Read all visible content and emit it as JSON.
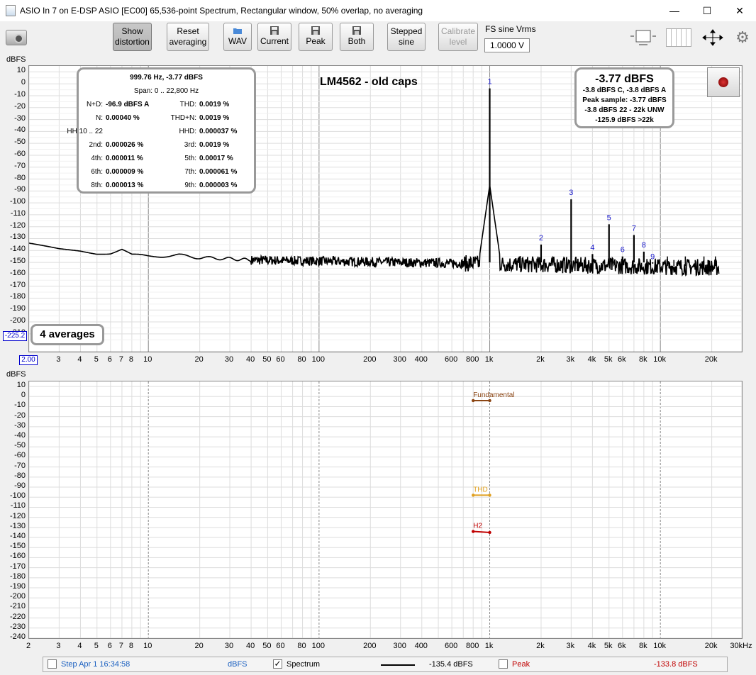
{
  "window": {
    "title": "ASIO In 7 on E-DSP ASIO [EC00] 65,536-point Spectrum, Rectangular window, 50% overlap, no averaging",
    "min": "—",
    "max": "☐",
    "close": "✕"
  },
  "toolbar": {
    "show_distortion": [
      "Show",
      "distortion"
    ],
    "reset_averaging": [
      "Reset",
      "averaging"
    ],
    "wav": "WAV",
    "current": "Current",
    "peak": "Peak",
    "both": "Both",
    "stepped_sine": [
      "Stepped",
      "sine"
    ],
    "calibrate_level": [
      "Calibrate",
      "level"
    ],
    "fs_label": "FS sine Vrms",
    "fs_value": "1.0000 V"
  },
  "spectrum": {
    "y_unit": "dBFS",
    "y_ticks": [
      10,
      0,
      -10,
      -20,
      -30,
      -40,
      -50,
      -60,
      -70,
      -80,
      -90,
      -100,
      -110,
      -120,
      -130,
      -140,
      -150,
      -160,
      -170,
      -180,
      -190,
      -200,
      -210
    ],
    "x_ticks": [
      {
        "v": 3,
        "t": "3"
      },
      {
        "v": 4,
        "t": "4"
      },
      {
        "v": 5,
        "t": "5"
      },
      {
        "v": 6,
        "t": "6"
      },
      {
        "v": 7,
        "t": "7"
      },
      {
        "v": 8,
        "t": "8"
      },
      {
        "v": 10,
        "t": "10"
      },
      {
        "v": 20,
        "t": "20"
      },
      {
        "v": 30,
        "t": "30"
      },
      {
        "v": 40,
        "t": "40"
      },
      {
        "v": 50,
        "t": "50"
      },
      {
        "v": 60,
        "t": "60"
      },
      {
        "v": 80,
        "t": "80"
      },
      {
        "v": 100,
        "t": "100"
      },
      {
        "v": 200,
        "t": "200"
      },
      {
        "v": 300,
        "t": "300"
      },
      {
        "v": 400,
        "t": "400"
      },
      {
        "v": 600,
        "t": "600"
      },
      {
        "v": 800,
        "t": "800"
      },
      {
        "v": 1000,
        "t": "1k"
      },
      {
        "v": 2000,
        "t": "2k"
      },
      {
        "v": 3000,
        "t": "3k"
      },
      {
        "v": 4000,
        "t": "4k"
      },
      {
        "v": 5000,
        "t": "5k"
      },
      {
        "v": 6000,
        "t": "6k"
      },
      {
        "v": 8000,
        "t": "8k"
      },
      {
        "v": 10000,
        "t": "10k"
      },
      {
        "v": 20000,
        "t": "20k"
      }
    ],
    "x_start": "2.00",
    "cursor_value": "-225.2",
    "title": "LM4562 - old caps",
    "averages": "4 averages",
    "harmonic_markers": [
      {
        "n": "1",
        "f": 1000,
        "db": -3.8
      },
      {
        "n": "2",
        "f": 2000,
        "db": -135
      },
      {
        "n": "3",
        "f": 3000,
        "db": -97
      },
      {
        "n": "4",
        "f": 4000,
        "db": -143
      },
      {
        "n": "5",
        "f": 5000,
        "db": -118
      },
      {
        "n": "6",
        "f": 6000,
        "db": -145
      },
      {
        "n": "7",
        "f": 7000,
        "db": -127
      },
      {
        "n": "8",
        "f": 8000,
        "db": -141
      },
      {
        "n": "9",
        "f": 9000,
        "db": -151
      }
    ],
    "stats": {
      "header": "999.76 Hz, -3.77 dBFS",
      "span": "Span: 0 .. 22,800 Hz",
      "rows": [
        {
          "k1": "N+D:",
          "v1": "-96.9 dBFS A",
          "k2": "THD:",
          "v2": "0.0019 %"
        },
        {
          "k1": "N:",
          "v1": "0.00040 %",
          "k2": "THD+N:",
          "v2": "0.0019 %"
        },
        {
          "k1": "HH 10 .. 22",
          "v1": "",
          "k2": "HHD:",
          "v2": "0.000037 %"
        },
        {
          "k1": "2nd:",
          "v1": "0.000026 %",
          "k2": "3rd:",
          "v2": "0.0019 %"
        },
        {
          "k1": "4th:",
          "v1": "0.000011 %",
          "k2": "5th:",
          "v2": "0.00017 %"
        },
        {
          "k1": "6th:",
          "v1": "0.000009 %",
          "k2": "7th:",
          "v2": "0.000061 %"
        },
        {
          "k1": "8th:",
          "v1": "0.000013 %",
          "k2": "9th:",
          "v2": "0.000003 %"
        }
      ]
    },
    "level": {
      "main": "-3.77 dBFS",
      "line1": "-3.8 dBFS C, -3.8 dBFS A",
      "line2": "Peak sample: -3.77 dBFS",
      "line3": "-3.8 dBFS 22 - 22k UNW",
      "line4": "-125.9 dBFS >22k"
    }
  },
  "distortion": {
    "y_unit": "dBFS",
    "y_ticks": [
      10,
      0,
      -10,
      -20,
      -30,
      -40,
      -50,
      -60,
      -70,
      -80,
      -90,
      -100,
      -110,
      -120,
      -130,
      -140,
      -150,
      -160,
      -170,
      -180,
      -190,
      -200,
      -210,
      -220,
      -230,
      -240
    ],
    "x_ticks": [
      {
        "v": 2,
        "t": "2"
      },
      {
        "v": 3,
        "t": "3"
      },
      {
        "v": 4,
        "t": "4"
      },
      {
        "v": 5,
        "t": "5"
      },
      {
        "v": 6,
        "t": "6"
      },
      {
        "v": 7,
        "t": "7"
      },
      {
        "v": 8,
        "t": "8"
      },
      {
        "v": 10,
        "t": "10"
      },
      {
        "v": 20,
        "t": "20"
      },
      {
        "v": 30,
        "t": "30"
      },
      {
        "v": 40,
        "t": "40"
      },
      {
        "v": 50,
        "t": "50"
      },
      {
        "v": 60,
        "t": "60"
      },
      {
        "v": 80,
        "t": "80"
      },
      {
        "v": 100,
        "t": "100"
      },
      {
        "v": 200,
        "t": "200"
      },
      {
        "v": 300,
        "t": "300"
      },
      {
        "v": 400,
        "t": "400"
      },
      {
        "v": 600,
        "t": "600"
      },
      {
        "v": 800,
        "t": "800"
      },
      {
        "v": 1000,
        "t": "1k"
      },
      {
        "v": 2000,
        "t": "2k"
      },
      {
        "v": 3000,
        "t": "3k"
      },
      {
        "v": 4000,
        "t": "4k"
      },
      {
        "v": 5000,
        "t": "5k"
      },
      {
        "v": 6000,
        "t": "6k"
      },
      {
        "v": 8000,
        "t": "8k"
      },
      {
        "v": 10000,
        "t": "10k"
      },
      {
        "v": 20000,
        "t": "20k"
      },
      {
        "v": 30000,
        "t": "30kHz"
      }
    ],
    "traces": [
      {
        "name": "Fundamental",
        "db": -4,
        "color": "#8b4513"
      },
      {
        "name": "THD",
        "db": -98,
        "color": "#e0a020"
      },
      {
        "name": "H2",
        "db": -135,
        "color": "#c00000"
      }
    ]
  },
  "chart_data": [
    {
      "type": "line",
      "title": "LM4562 - old caps",
      "ylabel": "dBFS",
      "xlabel": "",
      "x_scale": "log",
      "xlim": [
        2,
        30000
      ],
      "ylim": [
        -225,
        15
      ],
      "grid": true,
      "series": [
        {
          "x": [
            2,
            3,
            4,
            5,
            6,
            7,
            8,
            10,
            15,
            20,
            30,
            40,
            60,
            100,
            200,
            400,
            700,
            900,
            1000,
            1100,
            1500,
            2000,
            3000,
            4000,
            5000,
            6000,
            7000,
            8000,
            9000,
            10000,
            15000,
            20000,
            22000
          ],
          "y": [
            -135,
            -139,
            -140,
            -142,
            -142,
            -139,
            -144,
            -145,
            -144,
            -146,
            -147,
            -148,
            -149,
            -150,
            -151,
            -152,
            -149,
            -143,
            -3.8,
            -148,
            -152,
            -135,
            -97,
            -143,
            -118,
            -145,
            -127,
            -141,
            -151,
            -154,
            -154,
            -155,
            -158
          ]
        }
      ]
    },
    {
      "type": "line",
      "ylabel": "dBFS",
      "xlabel": "",
      "x_scale": "log",
      "xlim": [
        2,
        30000
      ],
      "ylim": [
        -240,
        15
      ],
      "grid": true,
      "series": [
        {
          "name": "Fundamental",
          "x": [
            800,
            1000
          ],
          "y": [
            -4,
            -4
          ]
        },
        {
          "name": "THD",
          "x": [
            800,
            1000
          ],
          "y": [
            -98,
            -98
          ]
        },
        {
          "name": "H2",
          "x": [
            800,
            1000
          ],
          "y": [
            -134,
            -135
          ]
        }
      ]
    }
  ],
  "legend": {
    "timestamp": "Step Apr 1 16:34:58",
    "unit": "dBFS",
    "spectrum_label": "Spectrum",
    "spectrum_checked": "✓",
    "spectrum_value": "-135.4 dBFS",
    "peak_label": "Peak",
    "peak_value": "-133.8 dBFS"
  }
}
